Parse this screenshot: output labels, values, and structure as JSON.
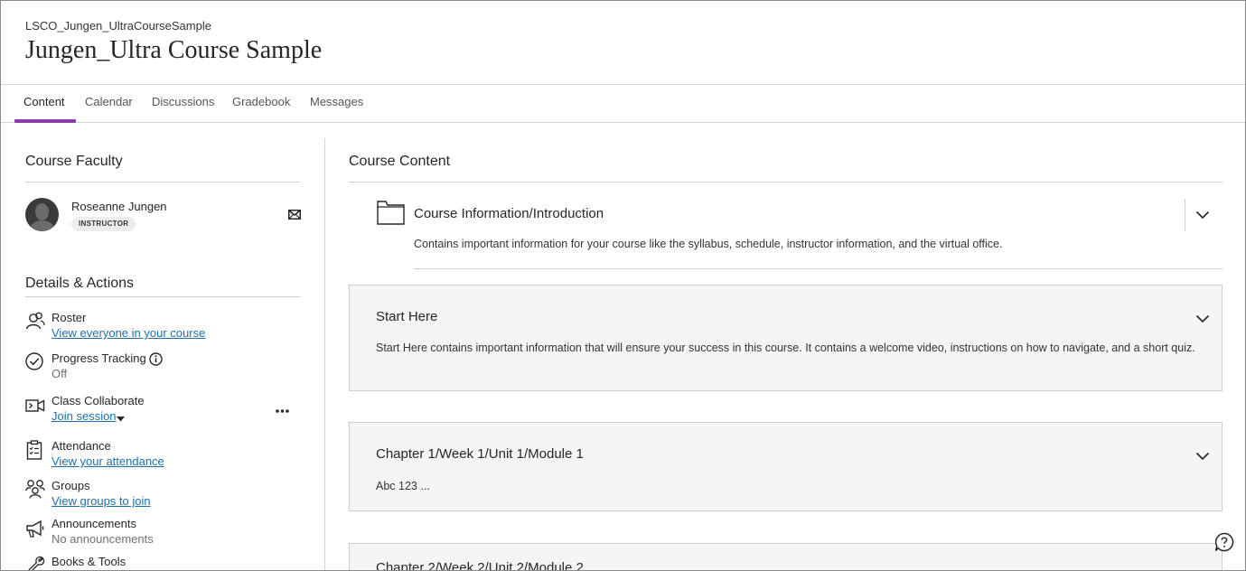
{
  "header": {
    "course_id": "LSCO_Jungen_UltraCourseSample",
    "course_title": "Jungen_Ultra Course Sample"
  },
  "tabs": [
    {
      "label": "Content",
      "active": true
    },
    {
      "label": "Calendar"
    },
    {
      "label": "Discussions"
    },
    {
      "label": "Gradebook"
    },
    {
      "label": "Messages"
    }
  ],
  "faculty": {
    "section_title": "Course Faculty",
    "name": "Roseanne Jungen",
    "role": "INSTRUCTOR",
    "message_icon": "envelope-icon"
  },
  "details": {
    "section_title": "Details & Actions",
    "items": [
      {
        "label": "Roster",
        "sub": "View everyone in your course",
        "icon": "roster-icon"
      },
      {
        "label": "Progress Tracking",
        "sub": "Off",
        "icon": "progress-check-icon"
      },
      {
        "label": "Class Collaborate",
        "sub": "Join session",
        "icon": "video-icon"
      },
      {
        "label": "Attendance",
        "sub": "View your attendance",
        "icon": "clipboard-icon"
      },
      {
        "label": "Groups",
        "sub": "View groups to join",
        "icon": "groups-icon"
      },
      {
        "label": "Announcements",
        "sub": "No announcements",
        "icon": "megaphone-icon"
      },
      {
        "label": "Books & Tools",
        "sub": "",
        "icon": "wrench-icon"
      }
    ]
  },
  "content": {
    "section_title": "Course Content",
    "folder": {
      "title": "Course Information/Introduction",
      "description": "Contains important information for your course like the syllabus, schedule, instructor information, and the virtual office."
    },
    "cards": [
      {
        "title": "Start Here",
        "description": "Start Here contains important information that will ensure your success in this course. It contains a welcome video, instructions on how to navigate, and a short quiz."
      },
      {
        "title": "Chapter 1/Week 1/Unit 1/Module 1",
        "description": "Abc 123 ..."
      },
      {
        "title": "Chapter 2/Week 2/Unit 2/Module 2",
        "description": ""
      }
    ]
  },
  "colors": {
    "accent": "#8b3aab",
    "link": "#1f6fa8"
  }
}
